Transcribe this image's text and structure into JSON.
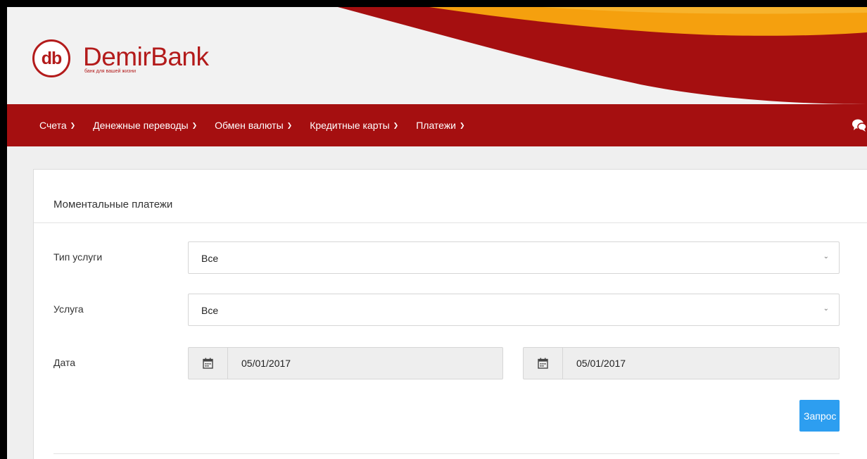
{
  "brand": {
    "monogram": "db",
    "name": "DemirBank",
    "tagline": "банк для вашей жизни",
    "colors": {
      "primary": "#a50f10",
      "accent": "#f5a00e",
      "button": "#2d9ef0"
    }
  },
  "nav": {
    "items": [
      {
        "label": "Счета"
      },
      {
        "label": "Денежные переводы"
      },
      {
        "label": "Обмен валюты"
      },
      {
        "label": "Кредитные карты"
      },
      {
        "label": "Платежи"
      }
    ],
    "chevron_icon": "chevron-down-icon",
    "chat_icon": "chat-bubbles-icon"
  },
  "panel": {
    "title": "Моментальные платежи",
    "fields": {
      "service_type": {
        "label": "Тип услуги",
        "value": "Все"
      },
      "service": {
        "label": "Услуга",
        "value": "Все"
      },
      "date": {
        "label": "Дата",
        "from": "05/01/2017",
        "to": "05/01/2017",
        "icon": "calendar-icon"
      }
    },
    "submit_label": "Запрос"
  }
}
